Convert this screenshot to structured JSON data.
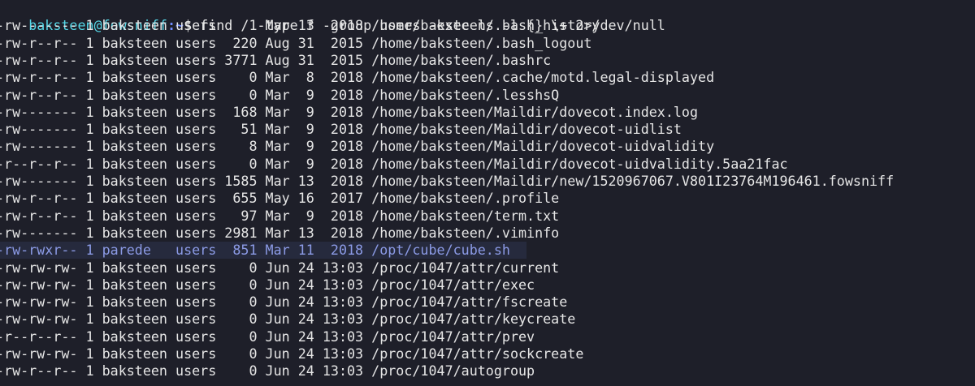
{
  "prompt": {
    "user": "baksteen",
    "at": "@",
    "host": "fowsniff",
    "path": ":~",
    "symbol": "$",
    "command": " find / -type f -group users -exec ls -l {} \\+ 2>/dev/null"
  },
  "output_lines": [
    "-rw------- 1 baksteen users    1 Mar 13  2018 /home/baksteen/.bash_history",
    "-rw-r--r-- 1 baksteen users  220 Aug 31  2015 /home/baksteen/.bash_logout",
    "-rw-r--r-- 1 baksteen users 3771 Aug 31  2015 /home/baksteen/.bashrc",
    "-rw-r--r-- 1 baksteen users    0 Mar  8  2018 /home/baksteen/.cache/motd.legal-displayed",
    "-rw-r--r-- 1 baksteen users    0 Mar  9  2018 /home/baksteen/.lesshsQ",
    "-rw------- 1 baksteen users  168 Mar  9  2018 /home/baksteen/Maildir/dovecot.index.log",
    "-rw------- 1 baksteen users   51 Mar  9  2018 /home/baksteen/Maildir/dovecot-uidlist",
    "-rw------- 1 baksteen users    8 Mar  9  2018 /home/baksteen/Maildir/dovecot-uidvalidity",
    "-r--r--r-- 1 baksteen users    0 Mar  9  2018 /home/baksteen/Maildir/dovecot-uidvalidity.5aa21fac",
    "-rw------- 1 baksteen users 1585 Mar 13  2018 /home/baksteen/Maildir/new/1520967067.V801I23764M196461.fowsniff",
    "-rw-r--r-- 1 baksteen users  655 May 16  2017 /home/baksteen/.profile",
    "-rw-r--r-- 1 baksteen users   97 Mar  9  2018 /home/baksteen/term.txt",
    "-rw------- 1 baksteen users 2981 Mar 13  2018 /home/baksteen/.viminfo",
    "-rw-rwxr-- 1 parede   users  851 Mar 11  2018 /opt/cube/cube.sh ",
    "-rw-rw-rw- 1 baksteen users    0 Jun 24 13:03 /proc/1047/attr/current",
    "-rw-rw-rw- 1 baksteen users    0 Jun 24 13:03 /proc/1047/attr/exec",
    "-rw-rw-rw- 1 baksteen users    0 Jun 24 13:03 /proc/1047/attr/fscreate",
    "-rw-rw-rw- 1 baksteen users    0 Jun 24 13:03 /proc/1047/attr/keycreate",
    "-r--r--r-- 1 baksteen users    0 Jun 24 13:03 /proc/1047/attr/prev",
    "-rw-rw-rw- 1 baksteen users    0 Jun 24 13:03 /proc/1047/attr/sockcreate",
    "-rw-r--r-- 1 baksteen users    0 Jun 24 13:03 /proc/1047/autogroup"
  ],
  "highlighted_line_index": 13,
  "colors": {
    "background": "#1e1f29",
    "text": "#e6e6e6",
    "prompt": "#56d8e8",
    "path": "#6f8cff",
    "highlight_bg": "#262a3d",
    "highlight_text": "#8c9be6"
  }
}
